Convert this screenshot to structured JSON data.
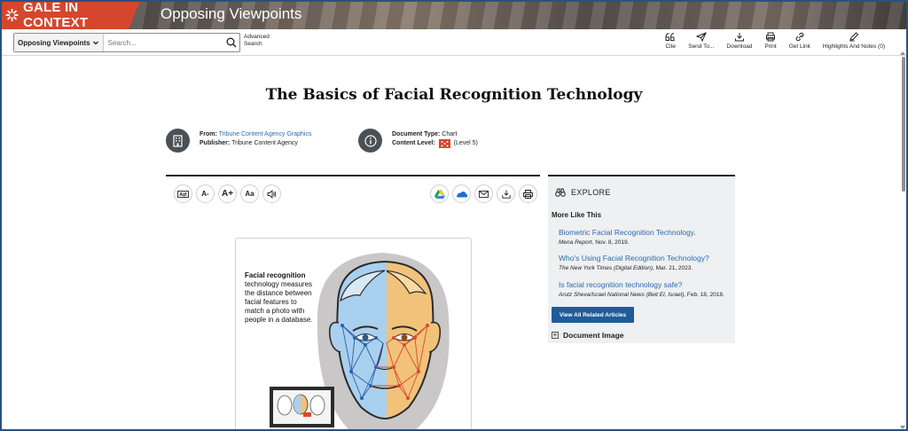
{
  "header": {
    "brand": "GALE IN CONTEXT",
    "product": "Opposing Viewpoints",
    "brand_color": "#d6462f"
  },
  "search": {
    "scope": "Opposing Viewpoints",
    "placeholder": "Search...",
    "advanced_line1": "Advanced",
    "advanced_line2": "Search"
  },
  "toolbar": {
    "cite": "Cite",
    "send": "Send To...",
    "download": "Download",
    "print": "Print",
    "link": "Get Link",
    "highlights": "Highlights And Notes (0)"
  },
  "document": {
    "title": "The Basics of Facial Recognition Technology",
    "from_label": "From:",
    "from_value": "Tribune Content Agency Graphics",
    "publisher_label": "Publisher:",
    "publisher_value": "Tribune Content Agency",
    "type_label": "Document Type:",
    "type_value": "Chart",
    "level_label": "Content Level:",
    "level_value": "(Level 5)"
  },
  "reader_tools": {
    "translate": "A⇄",
    "decrease": "A-",
    "increase": "A+",
    "font": "Aa"
  },
  "figure": {
    "lead": "Facial recognition",
    "body": "technology measures the distance between facial features to match a photo with people in a database."
  },
  "sidebar": {
    "explore": "EXPLORE",
    "more_like_this": "More Like This",
    "related": [
      {
        "title": "Biometric Facial Recognition Technology.",
        "source": "Mena Report",
        "date": ", Nov. 8, 2019."
      },
      {
        "title": "Who's Using Facial Recognition Technology?",
        "source": "The New York Times (Digital Edition)",
        "date": ", Mar. 21, 2023."
      },
      {
        "title": "Is facial recognition technology safe?",
        "source": "Arutz Sheva/Israel National News (Beit El, Israel)",
        "date": ", Feb. 18, 2018."
      }
    ],
    "view_all": "View All Related Articles",
    "doc_image": "Document Image"
  },
  "colors": {
    "link": "#2a6bb0",
    "button": "#1f5c99",
    "face_left": "#a9d0ee",
    "face_right": "#f2c27a"
  }
}
